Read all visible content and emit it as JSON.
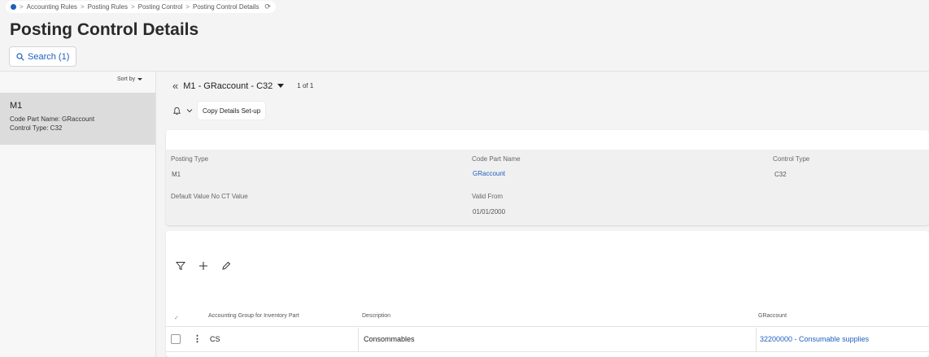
{
  "breadcrumb": {
    "items": [
      "Accounting Rules",
      "Posting Rules",
      "Posting Control",
      "Posting Control Details"
    ],
    "separator": ">"
  },
  "page_title": "Posting Control Details",
  "search_button": {
    "label": "Search (1)"
  },
  "left_panel": {
    "sort_label": "Sort by",
    "record": {
      "title": "M1",
      "code_part_label": "Code Part Name:",
      "code_part_value": "GRaccount",
      "control_type_label": "Control Type:",
      "control_type_value": "C32"
    }
  },
  "nav": {
    "record_label": "M1 - GRaccount - C32",
    "page_count": "1 of 1"
  },
  "actions": {
    "copy_details_label": "Copy Details Set-up"
  },
  "details": {
    "posting_type_label": "Posting Type",
    "posting_type_value": "M1",
    "code_part_name_label": "Code Part Name",
    "code_part_name_value": "GRaccount",
    "control_type_label": "Control Type",
    "control_type_value": "C32",
    "default_value_label": "Default Value No CT Value",
    "valid_from_label": "Valid From",
    "valid_from_value": "01/01/2000"
  },
  "grid": {
    "columns": [
      "Accounting Group for Inventory Part",
      "Description",
      "GRaccount"
    ],
    "rows": [
      {
        "group": "CS",
        "description": "Consommables",
        "account": "32200000 - Consumable supplies"
      }
    ]
  },
  "colors": {
    "accent": "#1f5fbf",
    "selected_card": "#dcdcdc"
  }
}
